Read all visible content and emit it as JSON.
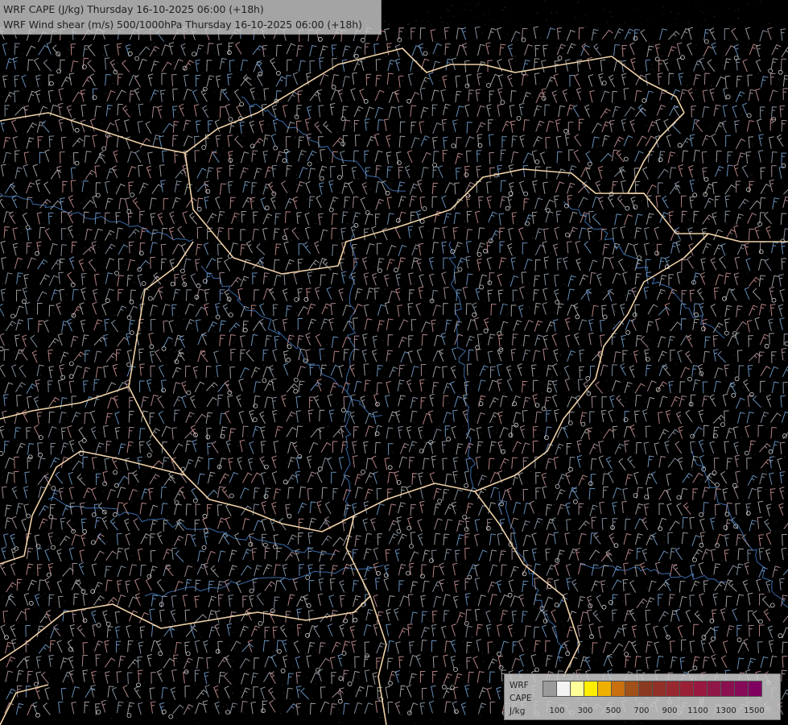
{
  "title": {
    "line1": "WRF CAPE (J/kg) Thursday 16-10-2025 06:00 (+18h)",
    "line2": "WRF Wind shear (m/s) 500/1000hPa Thursday 16-10-2025 06:00 (+18h)"
  },
  "legend": {
    "label_model": "WRF",
    "label_var": "CAPE",
    "label_unit": "J/kg",
    "swatch_colors": [
      "#9a9a9a",
      "#f2f2f2",
      "#ffff99",
      "#ffee00",
      "#f0b000",
      "#c87010",
      "#a05018",
      "#8a3a20",
      "#903028",
      "#982830",
      "#9a2038",
      "#981840",
      "#901848",
      "#8a1050",
      "#860a58",
      "#800060"
    ],
    "ticks": [
      "100",
      "300",
      "500",
      "700",
      "900",
      "1100",
      "1300",
      "1500"
    ]
  },
  "colors": {
    "background": "#000000",
    "border_line": "#f0d2a8",
    "barb_gray": "#b8b8b8",
    "barb_pink": "#d49a9a",
    "barb_blue": "#7aa8d8",
    "river_blue": "#3a6aa8"
  }
}
